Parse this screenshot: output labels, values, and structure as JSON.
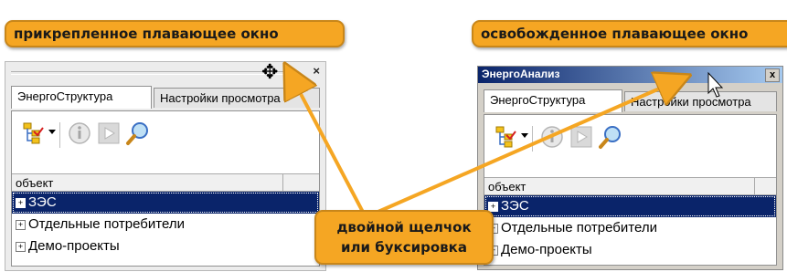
{
  "callouts": {
    "docked": "прикрепленное плавающее окно",
    "undocked": "освобожденное плавающее окно",
    "action_line1": "двойной щелчок",
    "action_line2": "или буксировка"
  },
  "docked_panel": {
    "close_glyph": "×",
    "tabs": [
      {
        "label": "ЭнергоСтруктура",
        "active": true
      },
      {
        "label": "Настройки просмотра",
        "active": false
      }
    ],
    "column_header": "объект",
    "rows": [
      {
        "label": "ЗЭС",
        "selected": true
      },
      {
        "label": "Отдельные потребители",
        "selected": false
      },
      {
        "label": "Демо-проекты",
        "selected": false
      }
    ]
  },
  "floating_panel": {
    "title": "ЭнергоАнализ",
    "close_glyph": "x",
    "tabs": [
      {
        "label": "ЭнергоСтруктура",
        "active": true
      },
      {
        "label": "Настройки просмотра",
        "active": false
      }
    ],
    "column_header": "объект",
    "rows": [
      {
        "label": "ЗЭС",
        "selected": true
      },
      {
        "label": "Отдельные потребители",
        "selected": false
      },
      {
        "label": "Демо-проекты",
        "selected": false
      }
    ]
  },
  "icons": [
    "tree-icon",
    "dropdown-arrow-icon",
    "info-icon",
    "play-icon",
    "search-icon",
    "move-cursor-icon",
    "mouse-pointer-icon"
  ],
  "colors": {
    "callout": "#f5a623",
    "selection": "#0a246a",
    "titlebar_start": "#0a246a",
    "titlebar_end": "#a6caf0"
  }
}
